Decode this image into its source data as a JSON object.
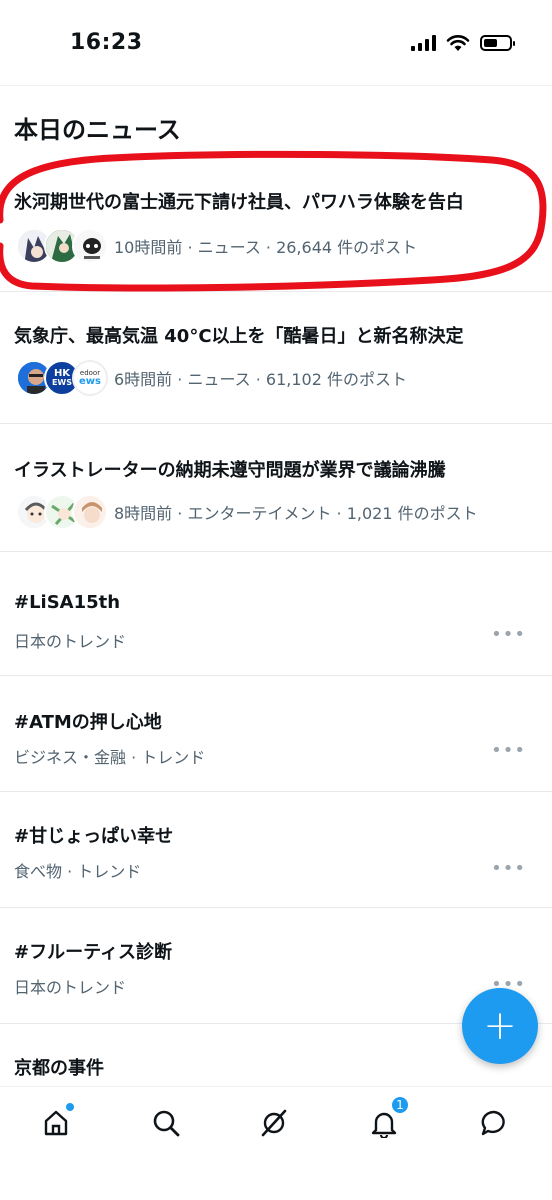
{
  "status_bar": {
    "time": "16:23"
  },
  "section": {
    "title": "本日のニュース"
  },
  "news": [
    {
      "title": "氷河期世代の富士通元下請け社員、パワハラ体験を告白",
      "meta": "10時間前 · ニュース · 26,644 件のポスト"
    },
    {
      "title": "気象庁、最高気温 40°C以上を「酷暑日」と新名称決定",
      "meta": "6時間前 · ニュース · 61,102 件のポスト",
      "avatar_text": [
        "HK",
        "EWS",
        "edoor",
        "ews"
      ]
    },
    {
      "title": "イラストレーターの納期未遵守問題が業界で議論沸騰",
      "meta": "8時間前 · エンターテイメント · 1,021 件のポスト"
    }
  ],
  "trends": [
    {
      "name": "#LiSA15th",
      "sub": "日本のトレンド"
    },
    {
      "name": "#ATMの押し心地",
      "sub": "ビジネス・金融 · トレンド"
    },
    {
      "name": "#甘じょっぱい幸せ",
      "sub": "食べ物 · トレンド"
    },
    {
      "name": "#フルーティス診断",
      "sub": "日本のトレンド"
    },
    {
      "name": "京都の事件",
      "sub": ""
    }
  ],
  "more_label": "•••",
  "fab": {
    "label": "+"
  },
  "tabbar": {
    "notification_count": "1"
  },
  "colors": {
    "accent": "#1d9bf0",
    "highlight": "#e8101a",
    "muted": "#536471"
  }
}
